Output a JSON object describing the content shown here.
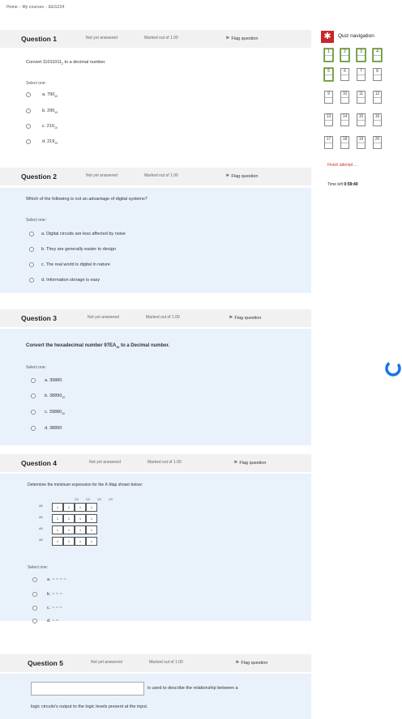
{
  "breadcrumb": [
    "Home",
    "My courses",
    "EEG224"
  ],
  "nav": {
    "title": "Quiz navigation",
    "numbers": [
      "1",
      "2",
      "3",
      "4",
      "5",
      "6",
      "7",
      "8",
      "9",
      "10",
      "11",
      "12",
      "13",
      "14",
      "15",
      "16",
      "17",
      "18",
      "19",
      "20"
    ],
    "finish": "Finish attempt ...",
    "time_label": "Time left",
    "time_value": "0:59:40"
  },
  "common": {
    "status": "Not yet answered",
    "marks": "Marked out of 1.00",
    "flag": "Flag question",
    "select_one": "Select one:"
  },
  "q1": {
    "num": "Question 1",
    "text_a": "Convert 11011011",
    "text_sub": "2",
    "text_b": " to a decimal number.",
    "options": [
      {
        "label": "a. 790",
        "sub": "10"
      },
      {
        "label": "b. 290",
        "sub": "10"
      },
      {
        "label": "c. 210",
        "sub": "10"
      },
      {
        "label": "d. 219",
        "sub": "10"
      }
    ]
  },
  "q2": {
    "num": "Question 2",
    "text": "Which of the following is not an advantage of digital systems?",
    "options": [
      "a. Digital circuits are less affected by noise",
      "b. They are generally easier to design",
      "c. The real world is digital in nature",
      "d. Information storage is easy"
    ]
  },
  "q3": {
    "num": "Question 3",
    "text_a": "Convert the hexadecimal number 97EA",
    "text_sub": "16",
    "text_b": " to a Decimal number.",
    "options": [
      {
        "label": "a. 39880",
        "sub": ""
      },
      {
        "label": "b. 38890",
        "sub": "10"
      },
      {
        "label": "c. 39880",
        "sub": "10"
      },
      {
        "label": "d. 38890",
        "sub": ""
      }
    ]
  },
  "q4": {
    "num": "Question 4",
    "text": "Determine the minimum expression for the K-Map shown below:",
    "kmap": {
      "col_headers": [
        "CD",
        "CD",
        "CD",
        "CD"
      ],
      "row_headers": [
        "AB",
        "AB",
        "AB",
        "AB"
      ],
      "cells": [
        [
          "1",
          "1",
          "1",
          "1"
        ],
        [
          "1",
          "1",
          "1",
          "1"
        ],
        [
          "1",
          "1",
          "1",
          "1"
        ],
        [
          "1",
          "1",
          "1",
          "1"
        ]
      ]
    },
    "options": [
      "a. ~ ~ ~ ~",
      "b. ~ ~ ~",
      "c. ~ ~ ~",
      "d. ~ ~"
    ]
  },
  "q5": {
    "num": "Question 5",
    "text_a": "is used to describe the relationship between a",
    "text_b": "logic circuits's output to the logic levels present at the input."
  }
}
